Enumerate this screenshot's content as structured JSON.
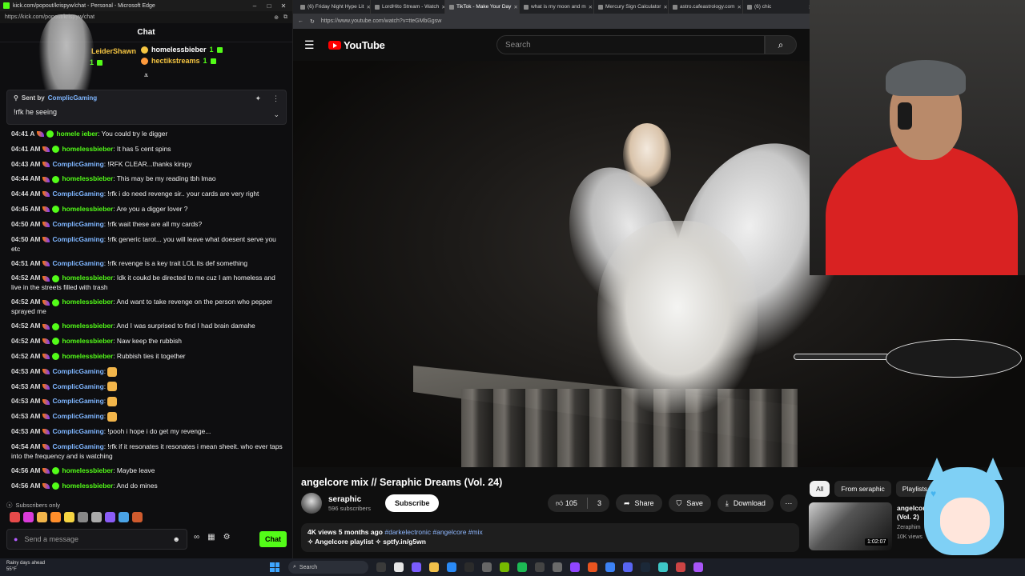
{
  "chat_window": {
    "titlebar": "kick.com/popout/krispyw/chat - Personal - Microsoft Edge",
    "url": "https://kick.com/popout/krispyw/chat",
    "header": "Chat",
    "gifters": [
      {
        "name": "LeiderShawn",
        "count": "1"
      },
      {
        "name": "homelessbieber",
        "count": "1"
      },
      {
        "name": "hectikstreams",
        "count": "1"
      }
    ],
    "pinned": {
      "label": "Sent by",
      "user": "ComplicGaming",
      "text": "!rfk he    seeing"
    },
    "messages": [
      {
        "ts": "04:41 A",
        "user": "homele    ieber",
        "type": "hb",
        "text": "You could try le digger"
      },
      {
        "ts": "04:41 AM",
        "user": "homelessbieber",
        "type": "hb",
        "text": "It has 5 cent spins"
      },
      {
        "ts": "04:43 AM",
        "user": "ComplicGaming",
        "type": "cg",
        "text": "!RFK CLEAR...thanks kirspy"
      },
      {
        "ts": "04:44 AM",
        "user": "homelessbieber",
        "type": "hb",
        "text": "This may be my reading tbh lmao"
      },
      {
        "ts": "04:44 AM",
        "user": "ComplicGaming",
        "type": "cg",
        "text": "!rfk i do need revenge sir.. your cards are very right"
      },
      {
        "ts": "04:45 AM",
        "user": "homelessbieber",
        "type": "hb",
        "text": "Are you a digger lover ?"
      },
      {
        "ts": "04:50 AM",
        "user": "ComplicGaming",
        "type": "cg",
        "text": "!rfk wait these are all my cards?"
      },
      {
        "ts": "04:50 AM",
        "user": "ComplicGaming",
        "type": "cg",
        "text": "!rfk generic tarot... you will leave what doesent serve you etc",
        "wrap": true
      },
      {
        "ts": "04:51 AM",
        "user": "ComplicGaming",
        "type": "cg",
        "text": "!rfk revenge is a key trait LOL its def something"
      },
      {
        "ts": "04:52 AM",
        "user": "homelessbieber",
        "type": "hb",
        "text": "Idk it coukd be directed to me cuz I am homeless and live in the streets filled with trash",
        "wrap": true
      },
      {
        "ts": "04:52 AM",
        "user": "homelessbieber",
        "type": "hb",
        "text": "And want to take revenge on the person who pepper sprayed me",
        "wrap": true
      },
      {
        "ts": "04:52 AM",
        "user": "homelessbieber",
        "type": "hb",
        "text": "And I was surprised to find I had brain damahe"
      },
      {
        "ts": "04:52 AM",
        "user": "homelessbieber",
        "type": "hb",
        "text": "Naw keep the rubbish"
      },
      {
        "ts": "04:52 AM",
        "user": "homelessbieber",
        "type": "hb",
        "text": "Rubbish ties it together"
      },
      {
        "ts": "04:53 AM",
        "user": "ComplicGaming",
        "type": "cg",
        "text": "",
        "emote": true
      },
      {
        "ts": "04:53 AM",
        "user": "ComplicGaming",
        "type": "cg",
        "text": "",
        "emote": true
      },
      {
        "ts": "04:53 AM",
        "user": "ComplicGaming",
        "type": "cg",
        "text": "",
        "emote": true
      },
      {
        "ts": "04:53 AM",
        "user": "ComplicGaming",
        "type": "cg",
        "text": "",
        "emote": true
      },
      {
        "ts": "04:53 AM",
        "user": "ComplicGaming",
        "type": "cg",
        "text": "!pooh i hope i do get my revenge..."
      },
      {
        "ts": "04:54 AM",
        "user": "ComplicGaming",
        "type": "cg",
        "text": "!rfk if it resonates it resonates i mean sheeit. who ever taps into the frequency and is watching",
        "wrap": true
      },
      {
        "ts": "04:56 AM",
        "user": "homelessbieber",
        "type": "hb",
        "text": "Maybe leave"
      },
      {
        "ts": "04:56 AM",
        "user": "homelessbieber",
        "type": "hb",
        "text": "And do mines"
      }
    ],
    "subscribers_only": "Subscribers only",
    "input_placeholder": "Send a message",
    "send_label": "Chat"
  },
  "browser": {
    "tabs": [
      {
        "label": "(6) Friday Night Hype Lit"
      },
      {
        "label": "LordHito Stream - Watch"
      },
      {
        "label": "TikTok - Make Your Day",
        "active": true
      },
      {
        "label": "what is my moon and m"
      },
      {
        "label": "Mercury Sign Calculator"
      },
      {
        "label": "astro.cafeastrology.com"
      },
      {
        "label": "(6) chic"
      }
    ],
    "url": "https://www.youtube.com/watch?v=tteGMbGgsw",
    "logo_text": "YouTube",
    "search_placeholder": "Search"
  },
  "video": {
    "title": "angelcore mix // Seraphic Dreams (Vol. 24)",
    "channel": "seraphic",
    "subscribers": "596 subscribers",
    "subscribe_label": "Subscribe",
    "likes": "105",
    "dislikes": "3",
    "share_label": "Share",
    "save_label": "Save",
    "download_label": "Download",
    "views_date": "4K views  5 months ago",
    "tags": "#darkelectronic #angelcore #mix",
    "desc_line": "✧ Angelcore playlist ✧ sptfy.in/g5wn"
  },
  "recommendations": {
    "chips": [
      {
        "label": "All",
        "active": true
      },
      {
        "label": "From seraphic"
      },
      {
        "label": "Playlists"
      }
    ],
    "item": {
      "title": "angelcore",
      "title2": "(Vol. 2)",
      "channel": "Zeraphim",
      "views": "10K views",
      "duration": "1:02:07"
    }
  },
  "taskbar": {
    "weather": "Rainy days ahead",
    "temp": "55°F",
    "search_placeholder": "Search"
  },
  "colors": {
    "kick_green": "#53fc18",
    "yt_red": "#ff0000",
    "cg_name": "#7fb6ff"
  }
}
